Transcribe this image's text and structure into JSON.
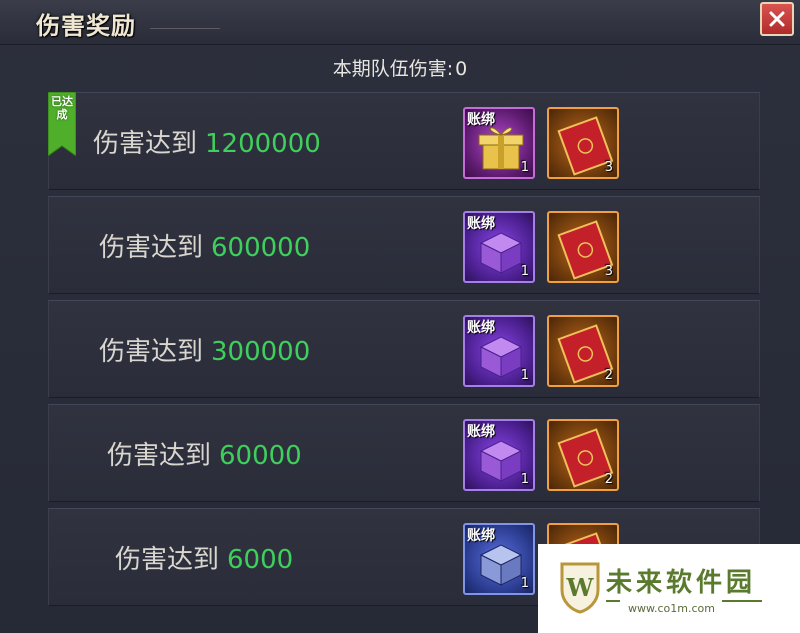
{
  "window": {
    "title": "伤害奖励",
    "close_icon": "close-icon"
  },
  "summary": {
    "label": "本期队伍伤害:",
    "value": "0"
  },
  "rewards": [
    {
      "label": "伤害达到",
      "threshold": "1200000",
      "achieved": true,
      "badge": "已达成",
      "items": [
        {
          "type": "gift-box-icon",
          "rarity": "pink",
          "bind_label": "账绑",
          "count": "1"
        },
        {
          "type": "red-ticket-icon",
          "rarity": "orange",
          "bind_label": "",
          "count": "3"
        }
      ]
    },
    {
      "label": "伤害达到",
      "threshold": "600000",
      "achieved": false,
      "items": [
        {
          "type": "chest-icon",
          "rarity": "purple",
          "bind_label": "账绑",
          "count": "1"
        },
        {
          "type": "red-ticket-icon",
          "rarity": "orange",
          "bind_label": "",
          "count": "3"
        }
      ]
    },
    {
      "label": "伤害达到",
      "threshold": "300000",
      "achieved": false,
      "items": [
        {
          "type": "chest-icon",
          "rarity": "purple",
          "bind_label": "账绑",
          "count": "1"
        },
        {
          "type": "red-ticket-icon",
          "rarity": "orange",
          "bind_label": "",
          "count": "2"
        }
      ]
    },
    {
      "label": "伤害达到",
      "threshold": "60000",
      "achieved": false,
      "items": [
        {
          "type": "chest-icon",
          "rarity": "purple",
          "bind_label": "账绑",
          "count": "1"
        },
        {
          "type": "red-ticket-icon",
          "rarity": "orange",
          "bind_label": "",
          "count": "2"
        }
      ]
    },
    {
      "label": "伤害达到",
      "threshold": "6000",
      "achieved": false,
      "items": [
        {
          "type": "chest-icon",
          "rarity": "blue",
          "bind_label": "账绑",
          "count": "1"
        },
        {
          "type": "red-ticket-icon",
          "rarity": "orange",
          "bind_label": "",
          "count": ""
        }
      ]
    }
  ],
  "watermark": {
    "text": "未来软件园",
    "url": "www.co1m.com",
    "logo_letter": "W"
  },
  "colors": {
    "threshold": "#3fcf5c",
    "badge": "#4fae2a",
    "close": "#c0392b"
  }
}
